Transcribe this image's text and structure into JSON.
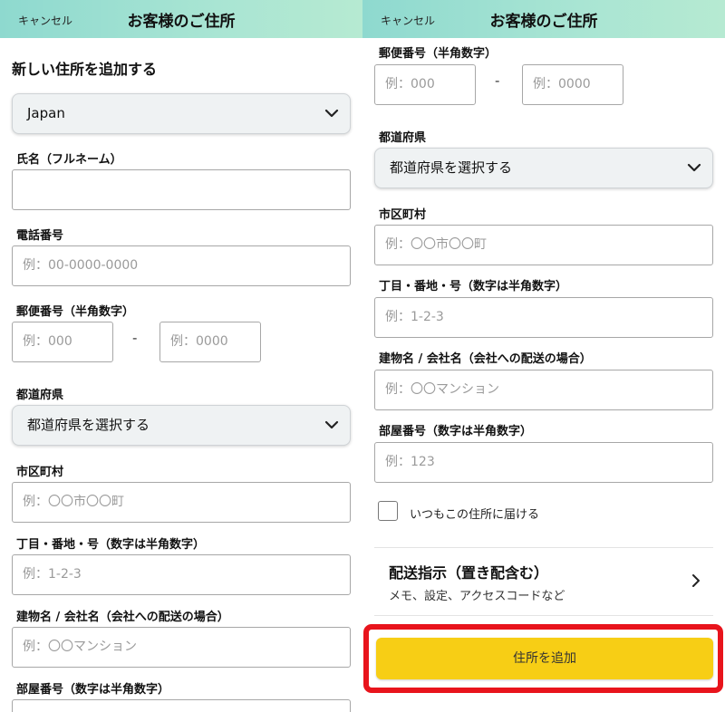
{
  "header": {
    "cancel_label": "キャンセル",
    "title": "お客様のご住所"
  },
  "left": {
    "section_title": "新しい住所を追加する",
    "country_value": "Japan",
    "name_label": "氏名（フルネーム）",
    "name_value": "",
    "phone_label": "電話番号",
    "phone_placeholder": "例：00-0000-0000",
    "postal_label": "郵便番号（半角数字）",
    "postal1_placeholder": "例：000",
    "postal_separator": "-",
    "postal2_placeholder": "例：0000",
    "prefecture_label": "都道府県",
    "prefecture_value": "都道府県を選択する",
    "city_label": "市区町村",
    "city_placeholder": "例：〇〇市〇〇町",
    "street_label": "丁目・番地・号（数字は半角数字）",
    "street_placeholder": "例：1-2-3",
    "building_label": "建物名 / 会社名（会社への配送の場合）",
    "building_placeholder": "例：〇〇マンション",
    "room_label": "部屋番号（数字は半角数字）"
  },
  "right": {
    "postal_label": "郵便番号（半角数字）",
    "postal1_placeholder": "例：000",
    "postal_separator": "-",
    "postal2_placeholder": "例：0000",
    "prefecture_label": "都道府県",
    "prefecture_value": "都道府県を選択する",
    "city_label": "市区町村",
    "city_placeholder": "例：〇〇市〇〇町",
    "street_label": "丁目・番地・号（数字は半角数字）",
    "street_placeholder": "例：1-2-3",
    "building_label": "建物名 / 会社名（会社への配送の場合）",
    "building_placeholder": "例：〇〇マンション",
    "room_label": "部屋番号（数字は半角数字）",
    "room_placeholder": "例：123",
    "default_address_label": "いつもこの住所に届ける",
    "delivery_title": "配送指示（置き配含む）",
    "delivery_subtitle": "メモ、設定、アクセスコードなど",
    "add_button_label": "住所を追加"
  },
  "colors": {
    "header_gradient_start": "#8ed9cf",
    "header_gradient_end": "#b6ead2",
    "add_button": "#f7ce15",
    "highlight_border": "#e8141c"
  },
  "icons": {
    "select_chevron": "chevron-down-icon",
    "row_chevron": "chevron-right-icon"
  }
}
